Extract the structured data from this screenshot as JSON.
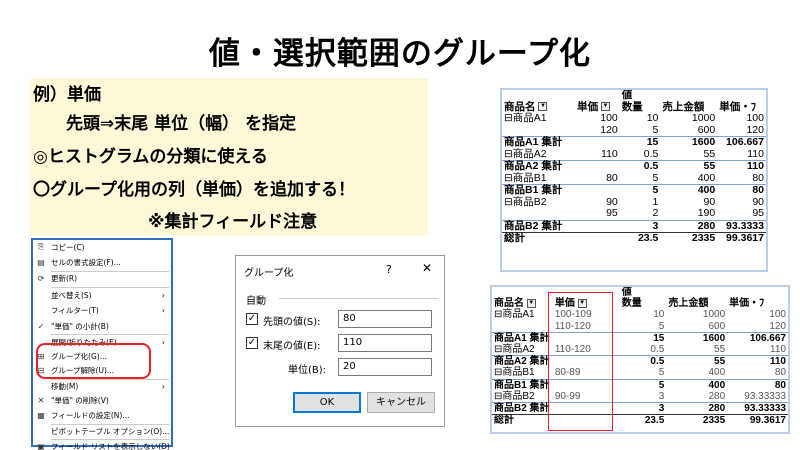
{
  "title": "値・選択範囲のグループ化",
  "notes": {
    "l1": "例）単価",
    "l2": "先頭⇒末尾 単位（幅） を指定",
    "l3": "◎ヒストグラムの分類に使える",
    "l4": "〇グループ化用の列（単価）を追加する！",
    "l5": "※集計フィールド注意"
  },
  "context_menu": {
    "items": [
      {
        "icon": "copy-icon",
        "glyph": "⎘",
        "label": "コピー(C)"
      },
      {
        "icon": "format-cells-icon",
        "glyph": "▤",
        "label": "セルの書式設定(F)..."
      },
      {
        "icon": "refresh-icon",
        "glyph": "⟳",
        "label": "更新(R)"
      },
      {
        "icon": "",
        "glyph": "",
        "label": "並べ替え(S)",
        "arrow": "›"
      },
      {
        "icon": "",
        "glyph": "",
        "label": "フィルター(T)",
        "arrow": "›"
      },
      {
        "icon": "check-icon",
        "glyph": "✓",
        "label": "\"単価\" の小計(B)"
      },
      {
        "icon": "",
        "glyph": "",
        "label": "展開/折りたたみ(E)",
        "arrow": "›"
      },
      {
        "icon": "group-icon",
        "glyph": "⊞",
        "label": "グループ化(G)..."
      },
      {
        "icon": "ungroup-icon",
        "glyph": "⊟",
        "label": "グループ解除(U)..."
      },
      {
        "icon": "",
        "glyph": "",
        "label": "移動(M)",
        "arrow": "›"
      },
      {
        "icon": "remove-icon",
        "glyph": "✕",
        "label": "\"単価\" の削除(V)"
      },
      {
        "icon": "field-settings-icon",
        "glyph": "▦",
        "label": "フィールドの設定(N)..."
      },
      {
        "icon": "",
        "glyph": "",
        "label": "ピボットテーブル オプション(O)..."
      },
      {
        "icon": "field-list-icon",
        "glyph": "▣",
        "label": "フィールド リストを表示しない(D)"
      }
    ]
  },
  "dialog": {
    "title": "グループ化",
    "help": "?",
    "close": "✕",
    "group_label": "自動",
    "start_label": "先頭の値(S):",
    "start_value": "80",
    "end_label": "末尾の値(E):",
    "end_value": "110",
    "unit_label": "単位(B):",
    "unit_value": "20",
    "ok": "OK",
    "cancel": "キャンセル"
  },
  "pivot1": {
    "values_header": "値",
    "headers": [
      "商品名",
      "単価",
      "数量",
      "売上金額",
      "単価・ﾌ"
    ],
    "rows": [
      {
        "type": "row",
        "c": [
          "⊟商品A1",
          "100",
          "10",
          "1000",
          "100"
        ]
      },
      {
        "type": "row",
        "c": [
          "",
          "120",
          "5",
          "600",
          "120"
        ]
      },
      {
        "type": "sub",
        "c": [
          "商品A1 集計",
          "",
          "15",
          "1600",
          "106.667"
        ]
      },
      {
        "type": "row",
        "c": [
          "⊟商品A2",
          "110",
          "0.5",
          "55",
          "110"
        ]
      },
      {
        "type": "sub",
        "c": [
          "商品A2 集計",
          "",
          "0.5",
          "55",
          "110"
        ]
      },
      {
        "type": "row",
        "c": [
          "⊟商品B1",
          "80",
          "5",
          "400",
          "80"
        ]
      },
      {
        "type": "sub",
        "c": [
          "商品B1 集計",
          "",
          "5",
          "400",
          "80"
        ]
      },
      {
        "type": "row",
        "c": [
          "⊟商品B2",
          "90",
          "1",
          "90",
          "90"
        ]
      },
      {
        "type": "row",
        "c": [
          "",
          "95",
          "2",
          "190",
          "95"
        ]
      },
      {
        "type": "sub",
        "c": [
          "商品B2 集計",
          "",
          "3",
          "280",
          "93.3333"
        ]
      },
      {
        "type": "tot",
        "c": [
          "総計",
          "",
          "23.5",
          "2335",
          "99.3617"
        ]
      }
    ]
  },
  "pivot2": {
    "values_header": "値",
    "headers": [
      "商品名",
      "単価",
      "数量",
      "売上金額",
      "単価・ﾌ"
    ],
    "rows": [
      {
        "type": "row",
        "c": [
          "⊟商品A1",
          "100-109",
          "10",
          "1000",
          "100"
        ]
      },
      {
        "type": "row",
        "c": [
          "",
          "110-120",
          "5",
          "600",
          "120"
        ]
      },
      {
        "type": "sub",
        "c": [
          "商品A1 集計",
          "",
          "15",
          "1600",
          "106.667"
        ]
      },
      {
        "type": "row",
        "c": [
          "⊟商品A2",
          "110-120",
          "0.5",
          "55",
          "110"
        ]
      },
      {
        "type": "sub",
        "c": [
          "商品A2 集計",
          "",
          "0.5",
          "55",
          "110"
        ]
      },
      {
        "type": "row",
        "c": [
          "⊟商品B1",
          "80-89",
          "5",
          "400",
          "80"
        ]
      },
      {
        "type": "sub",
        "c": [
          "商品B1 集計",
          "",
          "5",
          "400",
          "80"
        ]
      },
      {
        "type": "row",
        "c": [
          "⊟商品B2",
          "90-99",
          "3",
          "280",
          "93.33333"
        ]
      },
      {
        "type": "sub",
        "c": [
          "商品B2 集計",
          "",
          "3",
          "280",
          "93.33333"
        ]
      },
      {
        "type": "tot",
        "c": [
          "総計",
          "",
          "23.5",
          "2335",
          "99.3617"
        ]
      }
    ]
  },
  "colors": {
    "highlight": "#e8202a",
    "panel": "#fdf9d8",
    "menu_border": "#2d6fc0"
  }
}
